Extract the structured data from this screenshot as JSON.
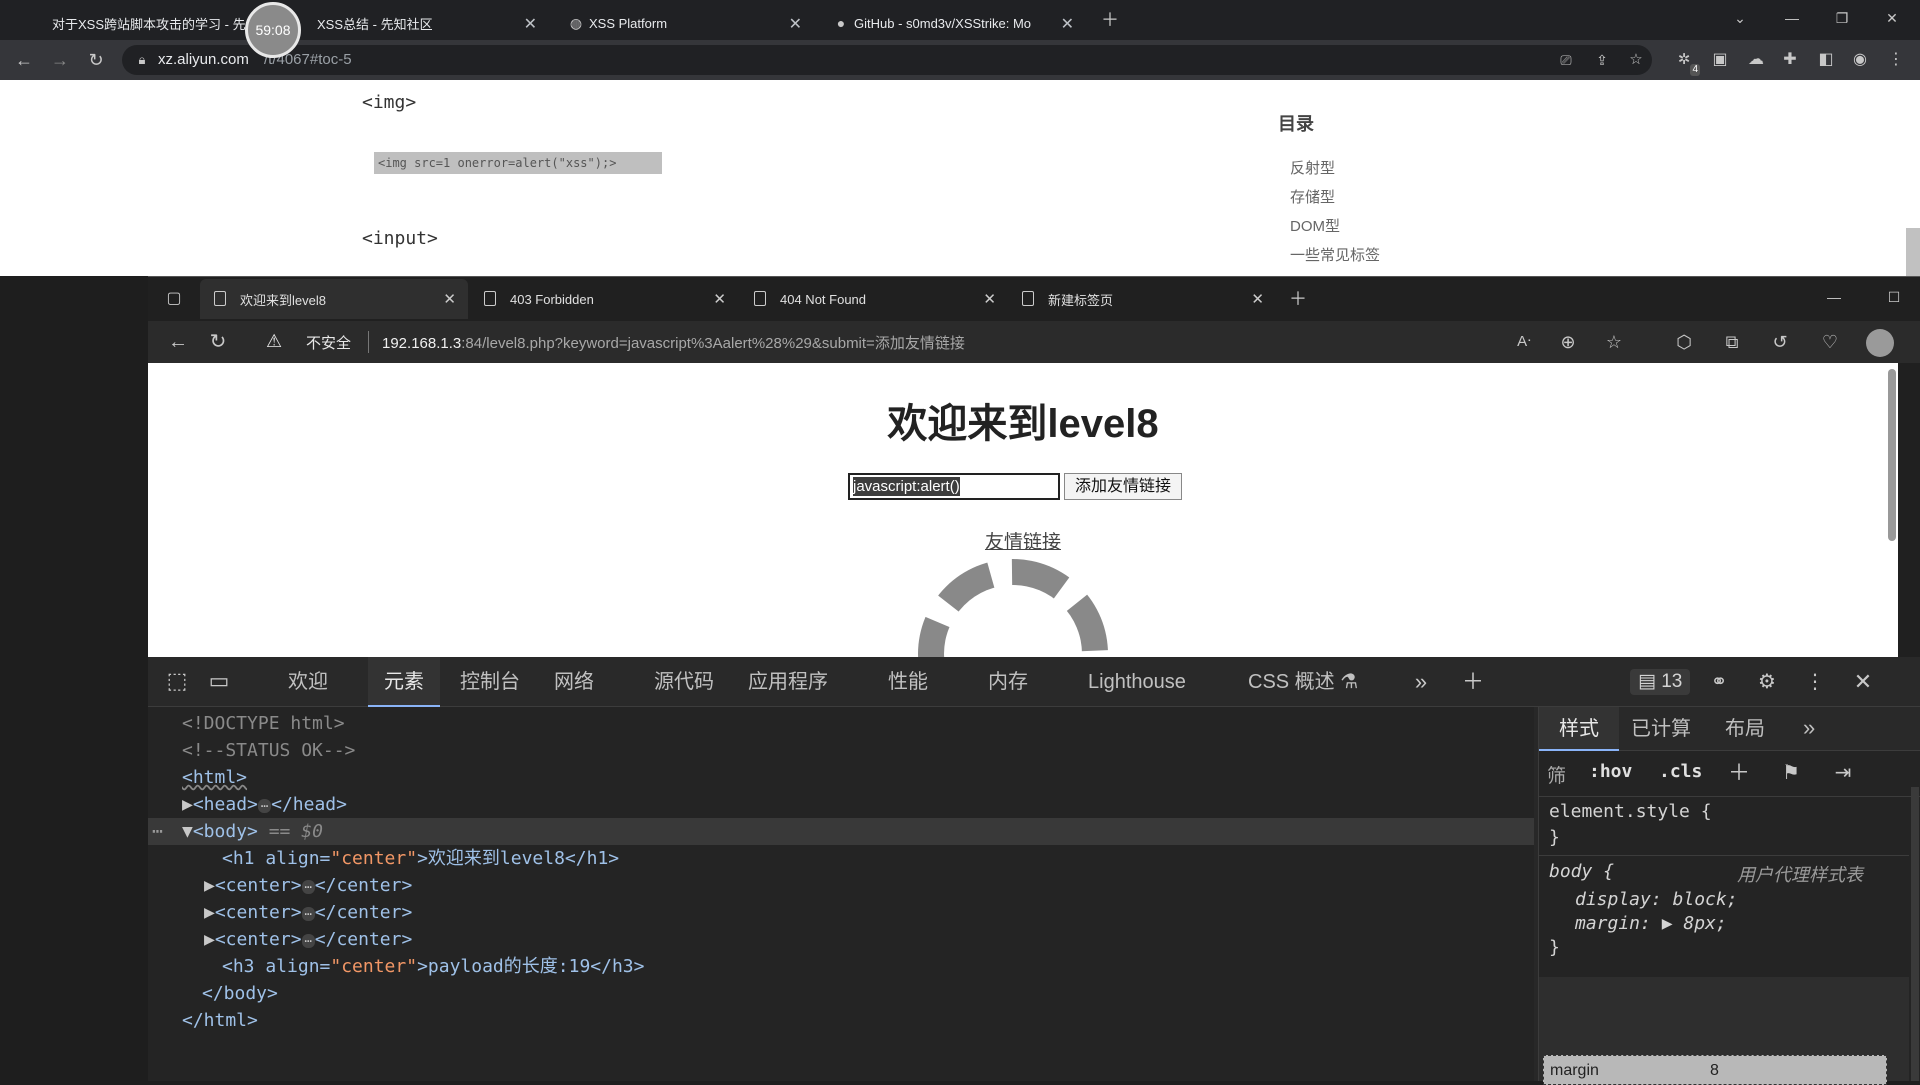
{
  "outer_browser": {
    "tabs": [
      {
        "title": "对于XSS跨站脚本攻击的学习 - 先"
      },
      {
        "title": "XSS总结 - 先知社区"
      },
      {
        "title": "XSS Platform"
      },
      {
        "title": "GitHub - s0md3v/XSStrike: Mo"
      }
    ],
    "timer": "59:08",
    "url_host": "xz.aliyun.com",
    "url_path": "/t/4067#toc-5",
    "extension_badge": "4"
  },
  "outer_page": {
    "tag_img": "<img>",
    "code_sample": "<img src=1 onerror=alert(\"xss\");>",
    "tag_input": "<input>",
    "toc_title": "目录",
    "toc_items": [
      "反射型",
      "存储型",
      "DOM型",
      "一些常见标签"
    ]
  },
  "inner_browser": {
    "tabs": [
      {
        "title": "欢迎来到level8"
      },
      {
        "title": "403 Forbidden"
      },
      {
        "title": "404 Not Found"
      },
      {
        "title": "新建标签页"
      }
    ],
    "security_label": "不安全",
    "url_host": "192.168.1.3",
    "url_rest": ":84/level8.php?keyword=javascript%3Aalert%28%29&submit=添加友情链接"
  },
  "page": {
    "heading": "欢迎来到level8",
    "input_value": "javascript:alert()",
    "submit_label": "添加友情链接",
    "link_text": "友情链接"
  },
  "devtools": {
    "tabs": [
      "欢迎",
      "元素",
      "控制台",
      "网络",
      "源代码",
      "应用程序",
      "性能",
      "内存",
      "Lighthouse",
      "CSS 概述"
    ],
    "active_tab": "元素",
    "issues_count": "13",
    "dom": {
      "doctype": "<!DOCTYPE html>",
      "comment": "<!--STATUS OK-->",
      "html_open": "<html>",
      "head_open": "<head>",
      "head_close": "</head>",
      "body_open": "<body>",
      "body_marker": "== $0",
      "h1_open": "<h1 align=",
      "h1_attr_val": "\"center\"",
      "h1_text": ">欢迎来到level8</h1>",
      "center_open": "<center>",
      "center_close": "</center>",
      "h3_open": "<h3 align=",
      "h3_attr_val": "\"center\"",
      "h3_text": ">payload的长度:19</h3>",
      "body_close": "</body>",
      "html_close": "</html>"
    },
    "styles": {
      "tabs": [
        "样式",
        "已计算",
        "布局"
      ],
      "filter_label": "筛",
      "hov": ":hov",
      "cls": ".cls",
      "element_style": "element.style {",
      "close_brace": "}",
      "body_selector": "body {",
      "ua_label": "用户代理样式表",
      "display_prop": "display: block;",
      "margin_prop": "margin: ▶ 8px;",
      "box_margin_label": "margin",
      "box_margin_value": "8"
    }
  }
}
